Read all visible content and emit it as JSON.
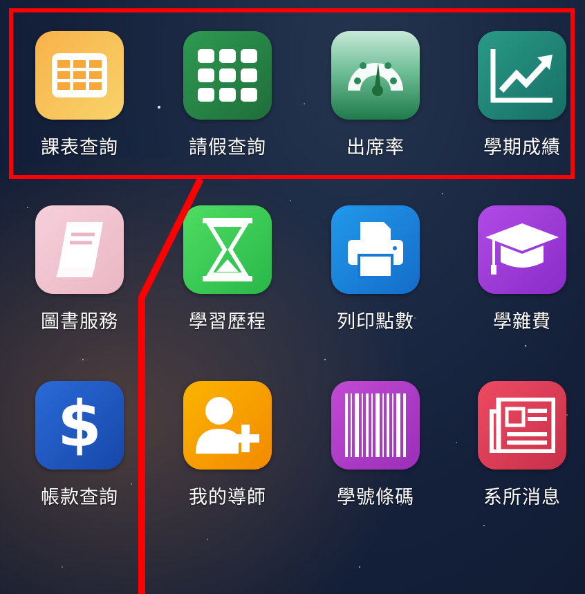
{
  "screen": {
    "apps": [
      {
        "label": "課表查詢",
        "icon": "grid-table-icon",
        "color": "#f5a23a"
      },
      {
        "label": "請假查詢",
        "icon": "dots-grid-icon",
        "color": "#2f8a4c"
      },
      {
        "label": "出席率",
        "icon": "gauge-icon",
        "color": "#2a8a5a"
      },
      {
        "label": "學期成績",
        "icon": "trend-chart-icon",
        "color": "#1f8a7e"
      },
      {
        "label": "圖書服務",
        "icon": "book-icon",
        "color": "#f3c5d0"
      },
      {
        "label": "學習歷程",
        "icon": "hourglass-icon",
        "color": "#3fcf5a"
      },
      {
        "label": "列印點數",
        "icon": "printer-icon",
        "color": "#1e88e5"
      },
      {
        "label": "學雜費",
        "icon": "graduation-cap-icon",
        "color": "#a33be0"
      },
      {
        "label": "帳款查詢",
        "icon": "dollar-icon",
        "color": "#1f5fc9"
      },
      {
        "label": "我的導師",
        "icon": "add-person-icon",
        "color": "#f5a000"
      },
      {
        "label": "學號條碼",
        "icon": "barcode-icon",
        "color": "#b43ec8"
      },
      {
        "label": "系所消息",
        "icon": "newspaper-icon",
        "color": "#e0405a"
      }
    ]
  },
  "annotation": {
    "color": "#ff0000"
  }
}
